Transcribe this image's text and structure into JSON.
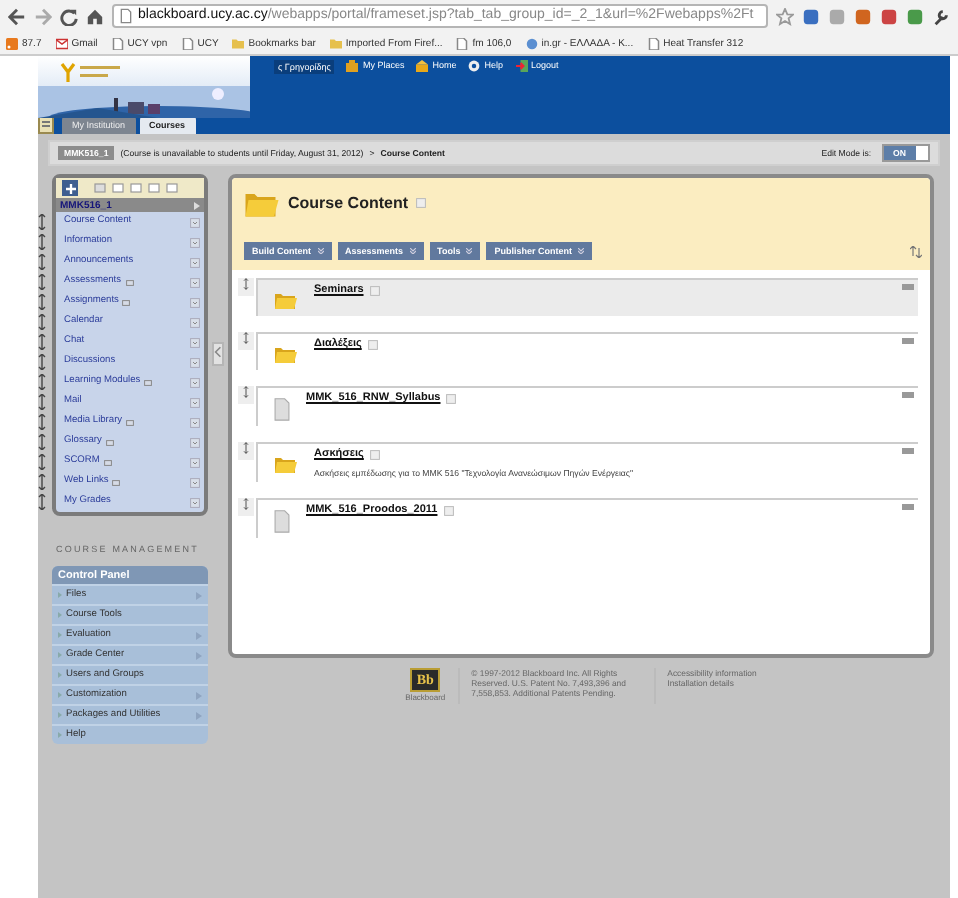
{
  "browser": {
    "url_host": "blackboard.ucy.ac.cy",
    "url_path": "/webapps/portal/frameset.jsp?tab_tab_group_id=_2_1&url=%2Fwebapps%2Ft",
    "bookmarks": [
      {
        "label": "87.7",
        "kind": "feed"
      },
      {
        "label": "Gmail",
        "kind": "mail"
      },
      {
        "label": "UCY vpn",
        "kind": "page"
      },
      {
        "label": "UCY",
        "kind": "page"
      },
      {
        "label": "Bookmarks bar",
        "kind": "folder"
      },
      {
        "label": "Imported From Firef...",
        "kind": "folder"
      },
      {
        "label": "fm 106,0",
        "kind": "page"
      },
      {
        "label": "in.gr - ΕΛΛΑΔΑ - Κ...",
        "kind": "web"
      },
      {
        "label": "Heat Transfer 312",
        "kind": "page"
      }
    ]
  },
  "header": {
    "user": "ς Γρηγορίδης",
    "links": [
      {
        "label": "My Places",
        "kind": "places"
      },
      {
        "label": "Home",
        "kind": "home"
      },
      {
        "label": "Help",
        "kind": "help"
      },
      {
        "label": "Logout",
        "kind": "logout"
      }
    ],
    "tabs": [
      {
        "label": "My Institution",
        "selected": false
      },
      {
        "label": "Courses",
        "selected": true
      }
    ]
  },
  "breadcrumb": {
    "course": "MMK516_1",
    "note": "(Course is unavailable to students until Friday, August 31, 2012)",
    "separator": ">",
    "current": "Course Content",
    "edit_mode_label": "Edit Mode is:",
    "edit_mode": "ON"
  },
  "course_menu": {
    "title": "MMK516_1",
    "items": [
      {
        "label": "Course Content",
        "hidden": false
      },
      {
        "label": "Information",
        "hidden": false
      },
      {
        "label": "Announcements",
        "hidden": false
      },
      {
        "label": "Assessments",
        "hidden": true
      },
      {
        "label": "Assignments",
        "hidden": true
      },
      {
        "label": "Calendar",
        "hidden": false
      },
      {
        "label": "Chat",
        "hidden": false
      },
      {
        "label": "Discussions",
        "hidden": false
      },
      {
        "label": "Learning Modules",
        "hidden": true
      },
      {
        "label": "Mail",
        "hidden": false
      },
      {
        "label": "Media Library",
        "hidden": true
      },
      {
        "label": "Glossary",
        "hidden": true
      },
      {
        "label": "SCORM",
        "hidden": true
      },
      {
        "label": "Web Links",
        "hidden": true
      },
      {
        "label": "My Grades",
        "hidden": false
      }
    ]
  },
  "course_management": {
    "heading": "COURSE MANAGEMENT",
    "panel_title": "Control Panel",
    "items": [
      {
        "label": "Files",
        "submenu": true
      },
      {
        "label": "Course Tools",
        "submenu": false
      },
      {
        "label": "Evaluation",
        "submenu": true
      },
      {
        "label": "Grade Center",
        "submenu": true
      },
      {
        "label": "Users and Groups",
        "submenu": false
      },
      {
        "label": "Customization",
        "submenu": true
      },
      {
        "label": "Packages and Utilities",
        "submenu": true
      },
      {
        "label": "Help",
        "submenu": false
      }
    ]
  },
  "content": {
    "title": "Course Content",
    "actions": [
      "Build Content",
      "Assessments",
      "Tools",
      "Publisher Content"
    ],
    "items": [
      {
        "kind": "folder",
        "title": "Seminars",
        "highlighted": true
      },
      {
        "kind": "folder",
        "title": "Διαλέξεις",
        "highlighted": false
      },
      {
        "kind": "file",
        "title": "MMK_516_RNW_Syllabus",
        "highlighted": false
      },
      {
        "kind": "folder",
        "title": "Ασκήσεις",
        "description": "Ασκήσεις εμπέδωσης για το ΜΜΚ 516 \"Τεχνολογία Ανανεώσιμων Πηγών Ενέργειας\"",
        "highlighted": false
      },
      {
        "kind": "file",
        "title": "MMK_516_Proodos_2011",
        "highlighted": false
      }
    ]
  },
  "footer": {
    "logo": "Bb",
    "logo_caption": "Blackboard",
    "copyright": "© 1997-2012 Blackboard Inc. All Rights Reserved. U.S. Patent No. 7,493,396 and 7,558,853. Additional Patents Pending.",
    "links": [
      "Accessibility information",
      "Installation details"
    ]
  }
}
